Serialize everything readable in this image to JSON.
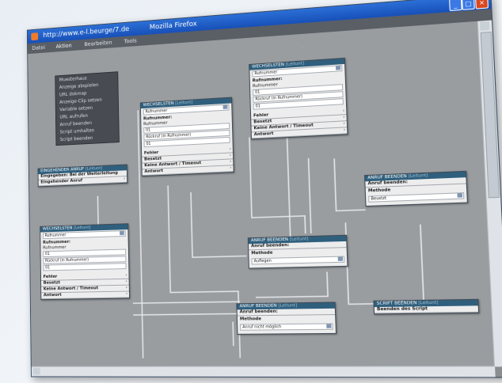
{
  "window": {
    "url": "http://www.e-l.beurge/7.de",
    "app": "Mozilla Firefox"
  },
  "menu": {
    "items": [
      "Datei",
      "Aktion",
      "Bearbeiten",
      "Tools"
    ]
  },
  "dropdown": {
    "items": [
      "Muesterhaus",
      "Anzeige abspielen",
      "URL dokmap",
      "Anzeige-Clip setzen",
      "Variable setzen",
      "URL aufrufen",
      "Anruf beenden",
      "Script umhalten",
      "Script beenden"
    ]
  },
  "nodes": {
    "dialog_top": {
      "title": "WECHSELSTEN",
      "ref": "[Leitunt]",
      "select": "Rufnummer",
      "field_label": "Rufnummer:",
      "sub_label": "Rufnummer",
      "val1": "01",
      "opt": "Rückruf (in Rufnummer)",
      "val2": "01",
      "rows": [
        "Fehler",
        "Besetzt",
        "Keine Antwort / Timeout",
        "Antwort"
      ]
    },
    "dialog_mid": {
      "title": "WECHSELSTEN",
      "ref": "[Leitunt]",
      "select": "Rufnummer",
      "field_label": "Rufnummer:",
      "sub_label": "Rufnummer",
      "val1": "01",
      "opt": "Rückruf (in Rufnummer)",
      "val2": "01",
      "rows": [
        "Fehler",
        "Besetzt",
        "Keine Antwort / Timeout",
        "Antwort"
      ]
    },
    "dialog_left": {
      "title": "WECHSELSTEN",
      "ref": "[Leitunt]",
      "select": "Rufnummer",
      "field_label": "Rufnummer:",
      "sub_label": "Rufnummer",
      "val1": "01",
      "opt": "Rückruf (in Rufnummer)",
      "val2": "01",
      "rows": [
        "Fehler",
        "Besetzt",
        "Keine Antwort / Timeout",
        "Antwort"
      ]
    },
    "incoming": {
      "title": "EINGEHENDER ANRUF",
      "ref": "[Leitunt]",
      "rows": [
        "Eingegeben: Bei der Weiterleitung",
        "Eingehender Anruf"
      ]
    },
    "end_right": {
      "title": "ANRUF BEENDEN",
      "ref": "[Leitunt]",
      "label": "Anruf beenden:",
      "sub": "Methode",
      "value": "Besetzt"
    },
    "end_mid": {
      "title": "ANRUF BEENDEN",
      "ref": "[Leitunt]",
      "label": "Anruf beenden:",
      "sub": "Methode",
      "value": "Auflegen"
    },
    "end_low": {
      "title": "ANRUF BEENDEN",
      "ref": "[Leitunt]",
      "label": "Anruf beenden:",
      "sub": "Methode",
      "value": "Anruf nicht möglich"
    },
    "script_end": {
      "title": "SCRIPT BEENDEN",
      "ref": "[Leitunt]",
      "row": "Beenden des Script"
    }
  }
}
